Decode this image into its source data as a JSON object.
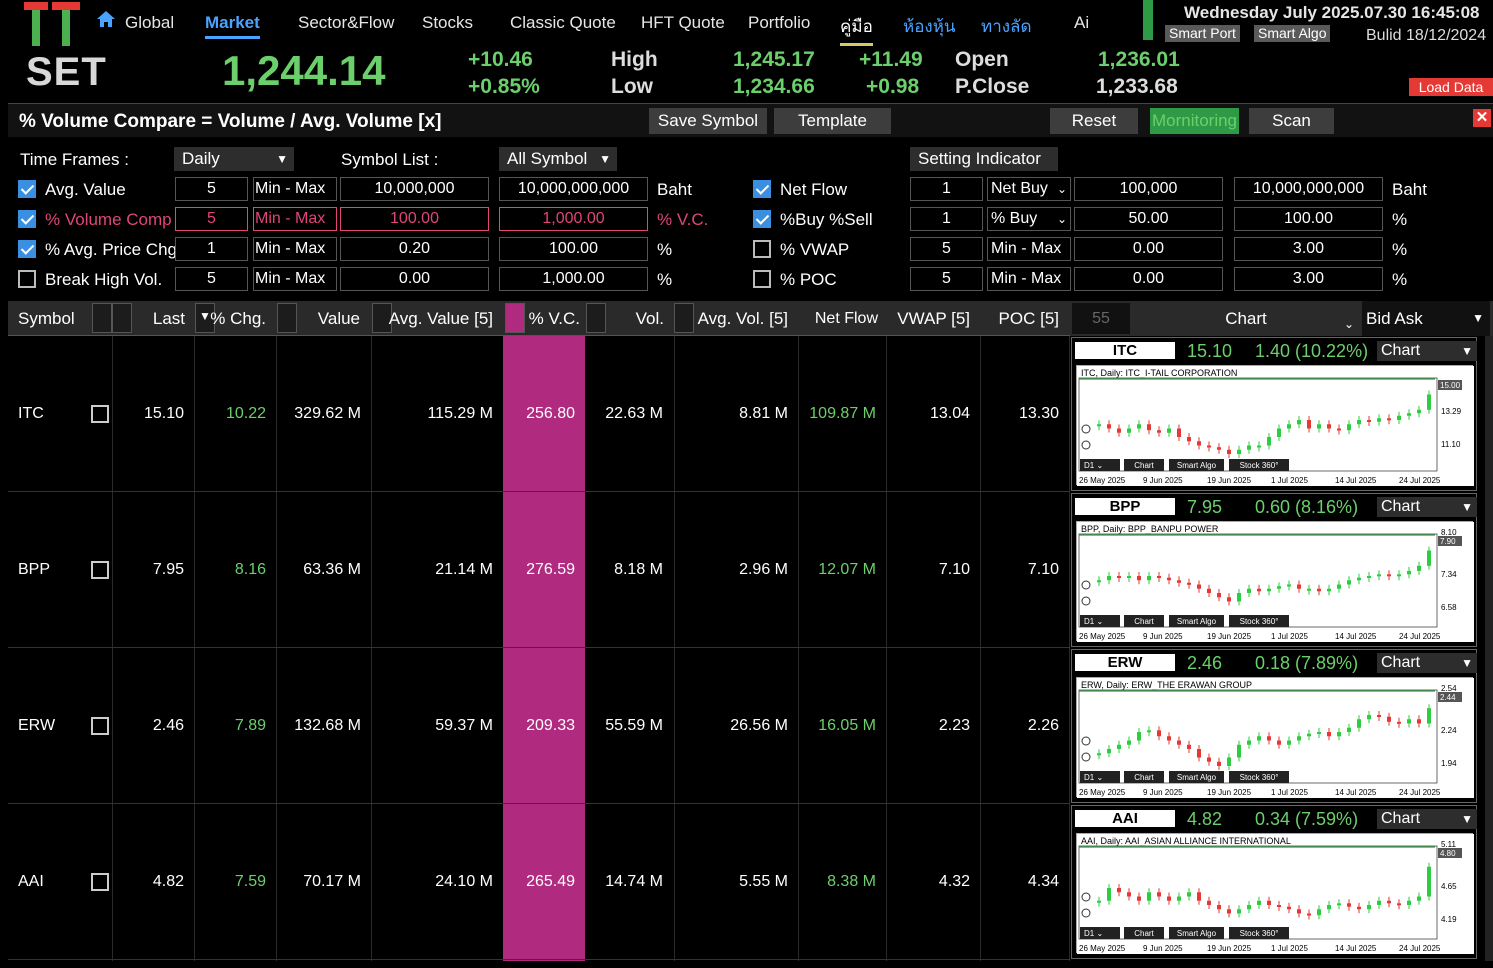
{
  "brand": {
    "logo_letters": "TT",
    "exchange": "SET"
  },
  "nav": [
    "Global",
    "Market",
    "Sector&Flow",
    "Stocks",
    "Classic Quote",
    "HFT Quote",
    "Portfolio",
    "คู่มือ",
    "ห้องหุ้น",
    "ทางลัด",
    "Ai"
  ],
  "datetime": "Wednesday July 2025.07.30 16:45:08",
  "build": "Bulid 18/12/2024",
  "top_buttons": {
    "smart_port": "Smart Port",
    "smart_algo": "Smart Algo",
    "load_data": "Load Data"
  },
  "index": {
    "value": "1,244.14",
    "change": "+10.46",
    "pct": "+0.85%",
    "high_label": "High",
    "low_label": "Low",
    "high": "1,245.17",
    "low": "1,234.66",
    "high_diff": "+11.49",
    "low_diff": "+0.98",
    "open_label": "Open",
    "pclose_label": "P.Close",
    "open": "1,236.01",
    "pclose": "1,233.68"
  },
  "panel": {
    "title": "% Volume Compare = Volume / Avg. Volume [x]",
    "buttons": [
      "Save Symbol",
      "Template",
      "Reset",
      "Mornitoring",
      "Scan"
    ],
    "close": "✕"
  },
  "filters": {
    "timeframe_label": "Time Frames :",
    "timeframe": "Daily",
    "symbol_list_label": "Symbol List :",
    "symbol_list": "All Symbol",
    "setting_indicator": "Setting Indicator",
    "left": [
      {
        "label": "Avg. Value",
        "checked": true,
        "n": "5",
        "mode": "Min - Max",
        "min": "10,000,000",
        "max": "10,000,000,000",
        "unit": "Baht",
        "red": false
      },
      {
        "label": "% Volume Comp",
        "checked": true,
        "n": "5",
        "mode": "Min - Max",
        "min": "100.00",
        "max": "1,000.00",
        "unit": "% V.C.",
        "red": true
      },
      {
        "label": "% Avg. Price Chg",
        "checked": true,
        "n": "1",
        "mode": "Min - Max",
        "min": "0.20",
        "max": "100.00",
        "unit": "%",
        "red": false
      },
      {
        "label": "Break High Vol.",
        "checked": false,
        "n": "5",
        "mode": "Min - Max",
        "min": "0.00",
        "max": "1,000.00",
        "unit": "%",
        "red": false
      }
    ],
    "right": [
      {
        "label": "Net Flow",
        "checked": true,
        "n": "1",
        "mode": "Net Buy",
        "dropdown": true,
        "min": "100,000",
        "max": "10,000,000,000",
        "unit": "Baht"
      },
      {
        "label": "%Buy %Sell",
        "checked": true,
        "n": "1",
        "mode": "% Buy",
        "dropdown": true,
        "min": "50.00",
        "max": "100.00",
        "unit": "%"
      },
      {
        "label": "% VWAP",
        "checked": false,
        "n": "5",
        "mode": "Min - Max",
        "dropdown": false,
        "min": "0.00",
        "max": "3.00",
        "unit": "%"
      },
      {
        "label": "% POC",
        "checked": false,
        "n": "5",
        "mode": "Min - Max",
        "dropdown": false,
        "min": "0.00",
        "max": "3.00",
        "unit": "%"
      }
    ]
  },
  "table": {
    "headers": {
      "symbol": "Symbol",
      "last": "Last",
      "chg": "% Chg.",
      "value": "Value",
      "avg_value": "Avg. Value [5]",
      "vc": "% V.C.",
      "vol": "Vol.",
      "avg_vol": "Avg. Vol. [5]",
      "net_flow": "Net Flow",
      "vwap": "VWAP [5]",
      "poc": "POC [5]",
      "count": "55",
      "chart": "Chart",
      "bid_ask": "Bid Ask"
    },
    "rows": [
      {
        "symbol": "ITC",
        "last": "15.10",
        "chg": "10.22",
        "value": "329.62 M",
        "avg_value": "115.29 M",
        "vc": "256.80",
        "vol": "22.63 M",
        "avg_vol": "8.81 M",
        "net_flow": "109.87 M",
        "vwap": "13.04",
        "poc": "13.30"
      },
      {
        "symbol": "BPP",
        "last": "7.95",
        "chg": "8.16",
        "value": "63.36 M",
        "avg_value": "21.14 M",
        "vc": "276.59",
        "vol": "8.18 M",
        "avg_vol": "2.96 M",
        "net_flow": "12.07 M",
        "vwap": "7.10",
        "poc": "7.10"
      },
      {
        "symbol": "ERW",
        "last": "2.46",
        "chg": "7.89",
        "value": "132.68 M",
        "avg_value": "59.37 M",
        "vc": "209.33",
        "vol": "55.59 M",
        "avg_vol": "26.56 M",
        "net_flow": "16.05 M",
        "vwap": "2.23",
        "poc": "2.26"
      },
      {
        "symbol": "AAI",
        "last": "4.82",
        "chg": "7.59",
        "value": "70.17 M",
        "avg_value": "24.10 M",
        "vc": "265.49",
        "vol": "14.74 M",
        "avg_vol": "5.55 M",
        "net_flow": "8.38 M",
        "vwap": "4.32",
        "poc": "4.34"
      }
    ]
  },
  "cards": [
    {
      "symbol": "ITC",
      "price": "15.10",
      "chg": "1.40 (10.22%)",
      "select": "Chart",
      "caption": "ITC, Daily:  ITC_I-TAIL CORPORATION",
      "last_tag": "15.00",
      "ticks": [
        "13.29",
        "11.10"
      ]
    },
    {
      "symbol": "BPP",
      "price": "7.95",
      "chg": "0.60 (8.16%)",
      "select": "Chart",
      "caption": "BPP, Daily:  BPP_BANPU POWER",
      "last_tag": "7.90",
      "ticks": [
        "8.10",
        "7.34",
        "6.58"
      ]
    },
    {
      "symbol": "ERW",
      "price": "2.46",
      "chg": "0.18 (7.89%)",
      "select": "Chart",
      "caption": "ERW, Daily:  ERW_THE ERAWAN GROUP",
      "last_tag": "2.44",
      "ticks": [
        "2.54",
        "2.24",
        "1.94"
      ]
    },
    {
      "symbol": "AAI",
      "price": "4.82",
      "chg": "0.34 (7.59%)",
      "select": "Chart",
      "caption": "AAI, Daily:  AAI_ASIAN ALLIANCE INTERNATIONAL",
      "last_tag": "4.80",
      "ticks": [
        "5.11",
        "4.65",
        "4.19"
      ]
    }
  ],
  "mini_chart": {
    "tf": "D1",
    "buttons": [
      "Chart",
      "Smart Algo",
      "Stock 360°"
    ],
    "dates": [
      "26 May 2025",
      "9 Jun 2025",
      "19 Jun 2025",
      "1 Jul 2025",
      "14 Jul 2025",
      "24 Jul 2025"
    ]
  },
  "colors": {
    "up": "#6bd06b",
    "down": "#e53935",
    "accent": "#4aa3ff",
    "highlight": "#b02a7f"
  }
}
